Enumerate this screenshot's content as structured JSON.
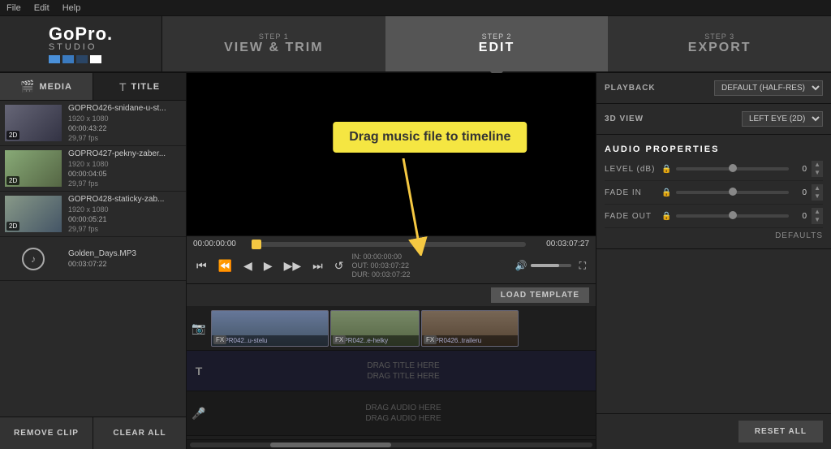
{
  "menubar": {
    "items": [
      "File",
      "Edit",
      "Help"
    ]
  },
  "header": {
    "logo": {
      "gopro": "GoPro.",
      "studio": "STUDIO"
    },
    "steps": [
      {
        "num": "STEP 1",
        "label": "VIEW & TRIM",
        "active": false
      },
      {
        "num": "STEP 2",
        "label": "EDIT",
        "active": true
      },
      {
        "num": "STEP 3",
        "label": "EXPORT",
        "active": false
      }
    ]
  },
  "left_panel": {
    "tabs": [
      {
        "label": "MEDIA",
        "active": true
      },
      {
        "label": "TITLE",
        "active": false
      }
    ],
    "media_items": [
      {
        "name": "GOPRO426-snidane-u-st...",
        "meta": "1920 x 1080",
        "fps": "29,97 fps",
        "time": "00:00:43:22",
        "badge": "2D",
        "type": "bus"
      },
      {
        "name": "GOPRO427-pekny-zaber...",
        "meta": "1920 x 1080",
        "fps": "29,97 fps",
        "time": "00:00:04:05",
        "badge": "2D",
        "type": "girl"
      },
      {
        "name": "GOPRO428-staticky-zab...",
        "meta": "1920 x 1080",
        "fps": "29,97 fps",
        "time": "00:00:05:21",
        "badge": "2D",
        "type": "road"
      },
      {
        "name": "Golden_Days.MP3",
        "meta": "",
        "fps": "",
        "time": "00:03:07:22",
        "badge": "",
        "type": "music"
      }
    ],
    "buttons": {
      "remove": "REMOVE CLIP",
      "clear": "CLEAR ALL"
    }
  },
  "center_panel": {
    "drag_tooltip": "Drag music file to timeline",
    "time_start": "00:00:00:00",
    "time_end": "00:03:07:27",
    "time_in": "IN: 00:00:00:00",
    "time_out": "OUT: 00:03:07:22",
    "time_dur": "DUR: 00:03:07:22",
    "load_template_btn": "LOAD TEMPLATE",
    "timeline_clips": [
      {
        "label": "GOPR042..u-stelu",
        "type": "clip1"
      },
      {
        "label": "GOPR042..e-helky",
        "type": "clip2"
      },
      {
        "label": "GOPR0426..traileru",
        "type": "clip3"
      }
    ],
    "title_placeholders": [
      "DRAG TITLE HERE",
      "DRAG TITLE HERE",
      "DRAG AUDIO HERE",
      "DRAG AUDIO HERE"
    ]
  },
  "right_panel": {
    "playback_label": "PLAYBACK",
    "playback_value": "DEFAULT (HALF-RES)",
    "view_3d_label": "3D VIEW",
    "view_3d_value": "LEFT EYE (2D)",
    "audio_props_title": "AUDIO PROPERTIES",
    "properties": [
      {
        "label": "LEVEL (dB)",
        "value": "0"
      },
      {
        "label": "FADE IN",
        "value": "0"
      },
      {
        "label": "FADE OUT",
        "value": "0"
      }
    ],
    "defaults_label": "DEFAULTS",
    "reset_btn": "RESET ALL"
  }
}
